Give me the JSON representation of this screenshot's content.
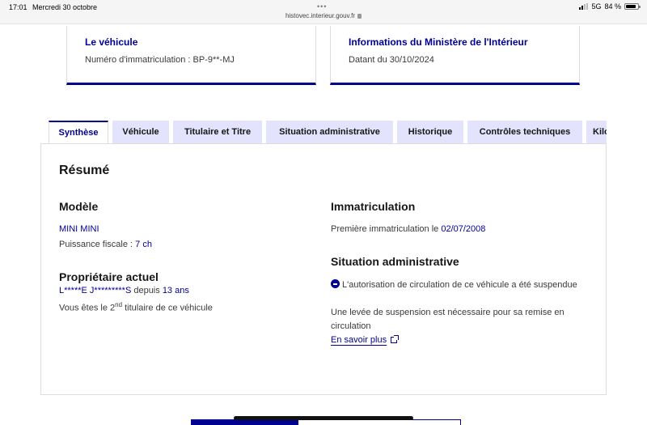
{
  "status_bar": {
    "time": "17:01",
    "date": "Mercredi 30 octobre",
    "url": "histovec.interieur.gouv.fr",
    "network": "5G",
    "battery": "84 %",
    "battery_level": 0.84,
    "icons": [
      "multitask-dots-icon",
      "lock-icon",
      "signal-icon",
      "battery-icon"
    ]
  },
  "cards": {
    "vehicle": {
      "title": "Le véhicule",
      "text": "Numéro d'immatriculation : BP-9**-MJ"
    },
    "ministry": {
      "title": "Informations du Ministère de l'Intérieur",
      "text": "Datant du 30/10/2024"
    }
  },
  "tabs": [
    {
      "label": "Synthèse",
      "active": true
    },
    {
      "label": "Véhicule",
      "active": false
    },
    {
      "label": "Titulaire et Titre",
      "active": false
    },
    {
      "label": "Situation administrative",
      "active": false
    },
    {
      "label": "Historique",
      "active": false
    },
    {
      "label": "Contrôles techniques",
      "active": false
    },
    {
      "label": "Kilo",
      "active": false
    }
  ],
  "summary": {
    "title": "Résumé",
    "model": {
      "heading": "Modèle",
      "name": "MINI MINI",
      "power_label": "Puissance fiscale : ",
      "power_value": "7 ch"
    },
    "owner": {
      "heading": "Propriétaire actuel",
      "name": "L*****E J*********S",
      "since_label": " depuis ",
      "since_value": "13 ans",
      "rank_prefix": "Vous êtes le ",
      "rank_number": "2",
      "rank_suffix": "nd",
      "rank_rest": " titulaire de ce véhicule"
    },
    "registration": {
      "heading": "Immatriculation",
      "first_label": "Première immatriculation le ",
      "first_date": "02/07/2008"
    },
    "admin": {
      "heading": "Situation administrative",
      "status_line": "L'autorisation de circulation de ce véhicule a été suspendue",
      "detail": "Une levée de suspension est nécessaire pour sa remise en circulation",
      "link": "En savoir plus"
    }
  },
  "colors": {
    "accent": "#000091",
    "tab_inactive": "#e3e3fd",
    "border": "#dddddd"
  }
}
